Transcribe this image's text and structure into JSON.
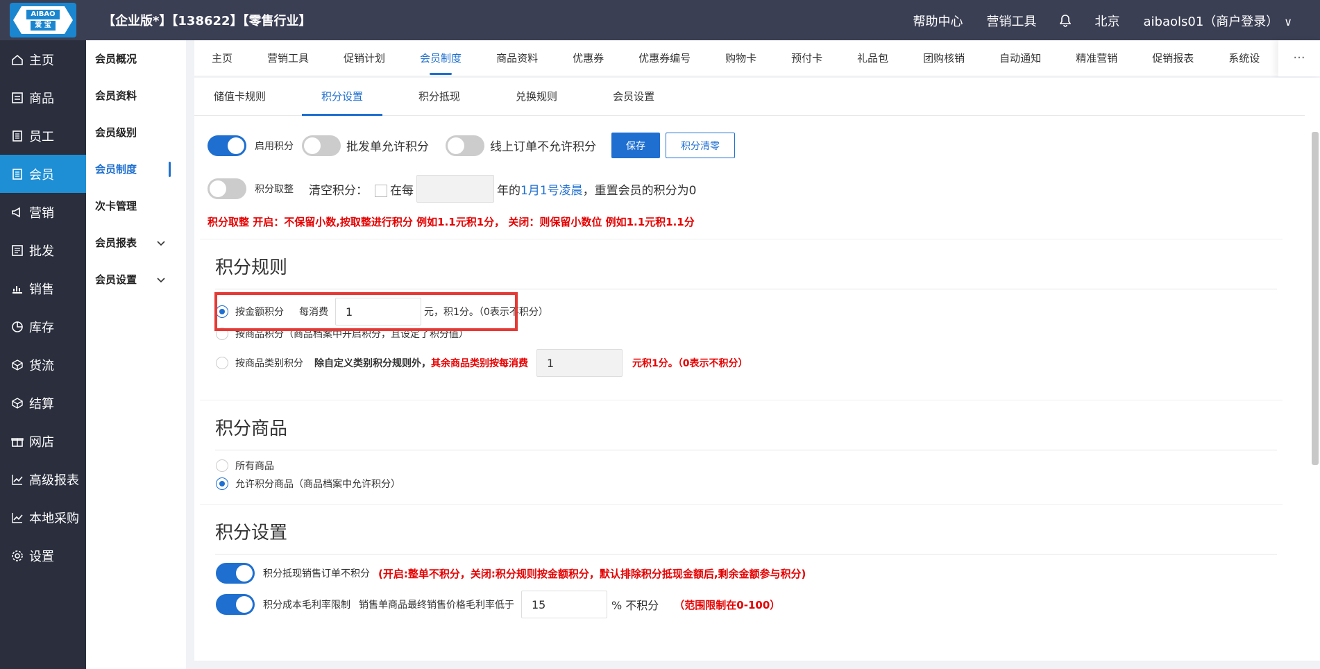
{
  "header": {
    "logo_top": "AIBAO",
    "logo_bottom": "爱 宝",
    "title": "【企业版*】【138622】【零售行业】",
    "links": [
      "帮助中心",
      "营销工具"
    ],
    "city": "北京",
    "user": "aibaols01（商户登录）"
  },
  "sidebar": {
    "items": [
      {
        "label": "主页",
        "icon": "home-icon"
      },
      {
        "label": "商品",
        "icon": "goods-icon"
      },
      {
        "label": "员工",
        "icon": "staff-icon"
      },
      {
        "label": "会员",
        "icon": "member-icon"
      },
      {
        "label": "营销",
        "icon": "marketing-icon"
      },
      {
        "label": "批发",
        "icon": "wholesale-icon"
      },
      {
        "label": "销售",
        "icon": "sales-chart-icon"
      },
      {
        "label": "库存",
        "icon": "inventory-pie-icon"
      },
      {
        "label": "货流",
        "icon": "logistics-icon"
      },
      {
        "label": "结算",
        "icon": "settlement-icon"
      },
      {
        "label": "网店",
        "icon": "gift-icon"
      },
      {
        "label": "高级报表",
        "icon": "line-chart-icon"
      },
      {
        "label": "本地采购",
        "icon": "line-chart-icon"
      },
      {
        "label": "设置",
        "icon": "gear-icon"
      }
    ]
  },
  "subsidebar": {
    "items": [
      "会员概况",
      "会员资料",
      "会员级别",
      "会员制度",
      "次卡管理",
      "会员报表",
      "会员设置"
    ]
  },
  "mainnav": {
    "tabs": [
      "主页",
      "营销工具",
      "促销计划",
      "会员制度",
      "商品资料",
      "优惠券",
      "优惠券编号",
      "购物卡",
      "预付卡",
      "礼品包",
      "团购核销",
      "自动通知",
      "精准营销",
      "促销报表",
      "系统设"
    ],
    "more": "···"
  },
  "subtabs": [
    "储值卡规则",
    "积分设置",
    "积分抵现",
    "兑换规则",
    "会员设置"
  ],
  "settings": {
    "enable_points": "启用积分",
    "wholesale_allow": "批发单允许积分",
    "online_disallow": "线上订单不允许积分",
    "save": "保存",
    "clear_points": "积分清零",
    "round_points": "积分取整",
    "clear_label": "清空积分：",
    "each": "在每",
    "year_of": "年的",
    "date_link": "1月1号凌晨",
    "reset_text": "，重置会员的积分为0",
    "round_note": "积分取整 开启：不保留小数,按取整进行积分 例如1.1元积1分， 关闭：则保留小数位 例如1.1元积1.1分"
  },
  "rules": {
    "title": "积分规则",
    "by_amount": "按金额积分",
    "per_spend": "每消费",
    "amount_value": "1",
    "amount_suffix": "元，积1分。（0表示不积分）",
    "by_goods": "按商品积分（商品档案中开启积分，且设定了积分值）",
    "by_category": "按商品类别积分",
    "category_note_bold": "除自定义类别积分规则外，",
    "category_note_red": "其余商品类别按每消费",
    "category_value": "1",
    "category_suffix": "元积1分。（0表示不积分）"
  },
  "goods": {
    "title": "积分商品",
    "all": "所有商品",
    "allowed": "允许积分商品（商品档案中允许积分）"
  },
  "points_settings": {
    "title": "积分设置",
    "offset_label": "积分抵现销售订单不积分",
    "offset_note": "(开启:整单不积分，关闭:积分规则按金额积分，默认排除积分抵现金额后,剩余金额参与积分)",
    "margin_label": "积分成本毛利率限制",
    "margin_desc": "销售单商品最终销售价格毛利率低于",
    "margin_value": "15",
    "margin_suffix": "% 不积分",
    "margin_note": "（范围限制在0-100）"
  },
  "colors": {
    "accent": "#1e6fd0",
    "topbar": "#3b3f54",
    "sidebar": "#2a2e3d",
    "sidebar_active": "#1e8fd5",
    "alert": "#e60000",
    "highlight_box": "#e53935"
  }
}
